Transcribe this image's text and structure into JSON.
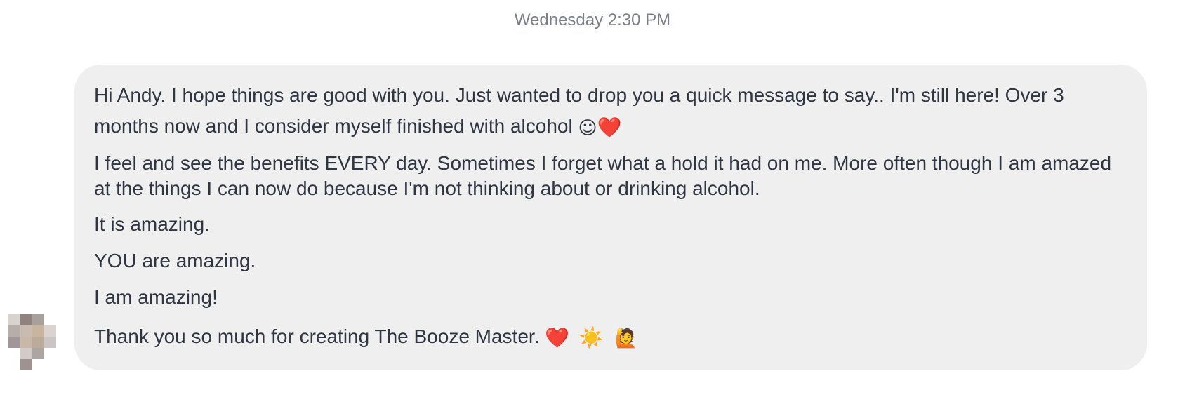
{
  "timestamp": "Wednesday 2:30 PM",
  "message": {
    "p1_text": "Hi Andy. I hope things are good with you. Just wanted to drop you a quick message to say.. I'm still here! Over 3 months now and I consider myself finished with alcohol ",
    "p1_emojis": [
      "☺",
      "❤️"
    ],
    "p2_text": "I feel and see the benefits EVERY day. Sometimes I forget what a hold it had on me. More often though I am amazed at the things I can now do because I'm not thinking about or drinking alcohol.",
    "p3_text": "It is amazing.",
    "p4_text": "YOU are amazing.",
    "p5_text": "I am amazing!",
    "p6_text": "Thank you so much for creating The Booze Master.",
    "p6_emojis": [
      "❤️",
      "☀️",
      "🙋"
    ]
  },
  "colors": {
    "bubble": "#efefef",
    "text": "#2f3542",
    "timestamp": "#7b8088",
    "heart": "#e11d2a",
    "sun": "#f3a712"
  },
  "icons": {
    "avatar": "blurred-profile-avatar",
    "smile": "smiling-face-icon",
    "heart": "heart-icon",
    "sun": "sun-icon",
    "wave": "person-raising-hand-icon"
  }
}
